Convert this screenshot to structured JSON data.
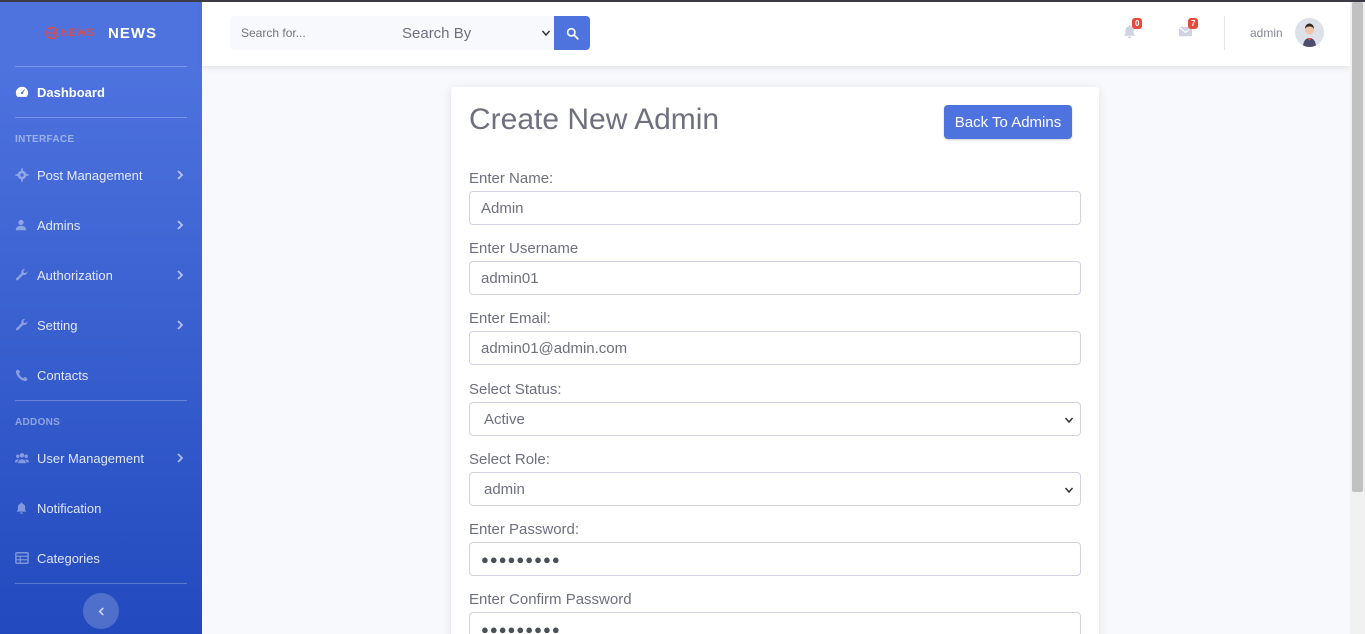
{
  "brand": {
    "logo_text": "NEWS",
    "name": "NEWS"
  },
  "sidebar": {
    "dashboard": "Dashboard",
    "heading_interface": "INTERFACE",
    "heading_addons": "ADDONS",
    "items": [
      {
        "label": "Post Management",
        "icon": "cog-icon",
        "has_chevron": true
      },
      {
        "label": "Admins",
        "icon": "user-icon",
        "has_chevron": true
      },
      {
        "label": "Authorization",
        "icon": "wrench-icon",
        "has_chevron": true
      },
      {
        "label": "Setting",
        "icon": "wrench-icon",
        "has_chevron": true
      },
      {
        "label": "Contacts",
        "icon": "phone-icon",
        "has_chevron": false
      }
    ],
    "addon_items": [
      {
        "label": "User Management",
        "icon": "users-icon",
        "has_chevron": true
      },
      {
        "label": "Notification",
        "icon": "bell-icon",
        "has_chevron": false
      },
      {
        "label": "Categories",
        "icon": "table-icon",
        "has_chevron": false
      }
    ]
  },
  "topbar": {
    "search_placeholder": "Search for...",
    "search_by": "Search By",
    "alerts_count": "0",
    "messages_count": "7",
    "user_name": "admin"
  },
  "form": {
    "title": "Create New Admin",
    "back_button": "Back To Admins",
    "name_label": "Enter Name:",
    "name_value": "Admin",
    "username_label": "Enter Username",
    "username_value": "admin01",
    "email_label": "Enter Email:",
    "email_value": "admin01@admin.com",
    "status_label": "Select Status:",
    "status_value": "Active",
    "role_label": "Select Role:",
    "role_value": "admin",
    "password_label": "Enter Password:",
    "password_value": "●●●●●●●●●",
    "confirm_label": "Enter Confirm Password",
    "confirm_value": "●●●●●●●●●"
  },
  "colors": {
    "primary": "#4e73df",
    "danger": "#e74a3b",
    "text": "#6e707e"
  }
}
